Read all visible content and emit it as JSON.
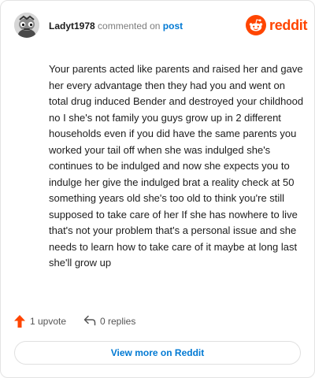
{
  "comment": {
    "username": "Ladyt1978",
    "action_text": "commented on",
    "post_link_label": "post",
    "body": "Your parents acted like parents and raised her and gave her every advantage then they had you and went on total drug induced Bender and destroyed your childhood no I she's not family you guys grow up in 2 different households even if you did have the same parents you worked your tail off when she was indulged she's continues to be indulged and now she expects you to indulge her give the indulged brat a reality check at 50 something years old she's too old to think you're still supposed to take care of her If she has nowhere to live that's not your problem that's a personal issue and she needs to learn how to take care of it maybe at long last she'll grow up"
  },
  "brand": {
    "name": "reddit",
    "icon": "reddit-logo-icon",
    "color": "#ff4500"
  },
  "stats": {
    "upvotes_label": "1 upvote",
    "replies_label": "0 replies",
    "upvote_icon": "upvote-arrow-icon",
    "reply_icon": "reply-arrow-icon"
  },
  "footer": {
    "view_more_label": "View more on Reddit"
  },
  "colors": {
    "link": "#0079d3",
    "upvote": "#ff4500",
    "text": "#1c1c1c",
    "muted": "#7c7c7c"
  }
}
